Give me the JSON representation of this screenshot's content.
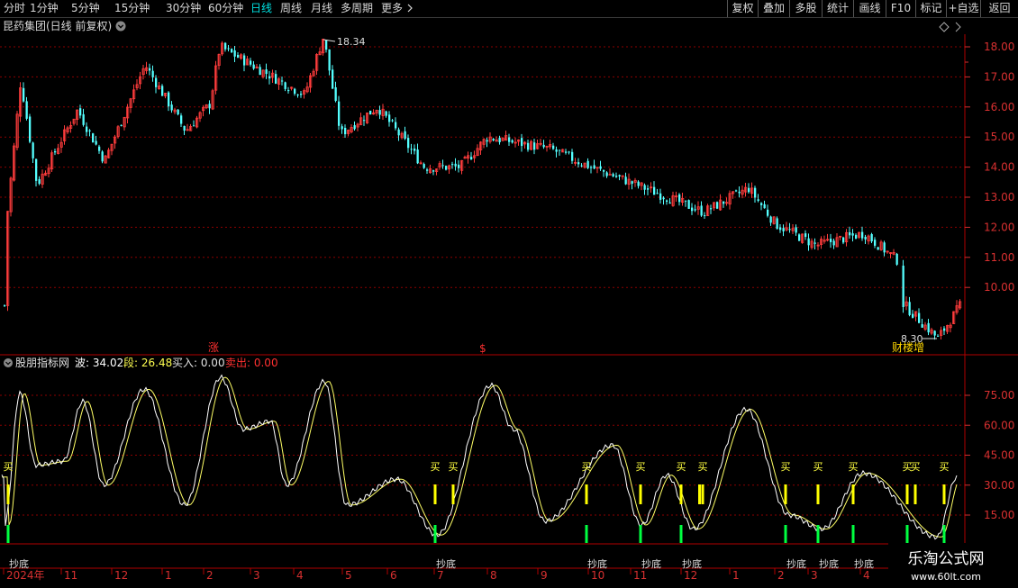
{
  "toolbar": {
    "timeframes": [
      {
        "label": "分时",
        "active": false
      },
      {
        "label": "1分钟",
        "active": false
      },
      {
        "label": "5分钟",
        "active": false
      },
      {
        "label": "15分钟",
        "active": false
      },
      {
        "label": "30分钟",
        "active": false
      },
      {
        "label": "60分钟",
        "active": false
      },
      {
        "label": "日线",
        "active": true
      },
      {
        "label": "周线",
        "active": false
      },
      {
        "label": "月线",
        "active": false
      },
      {
        "label": "多周期",
        "active": false
      }
    ],
    "more_label": "更多",
    "more_icon": "chevron-right-icon",
    "right_buttons": [
      "复权",
      "叠加",
      "多股",
      "统计",
      "画线",
      "F10",
      "标记",
      "+自选",
      "返回"
    ]
  },
  "header": {
    "stock_title": "昆药集团(日线 前复权)",
    "dropdown_icon": "chevron-down-icon",
    "diamond_icon": "diamond-icon"
  },
  "price_panel": {
    "high_label": "18.34",
    "low_label": "8.30",
    "markers": [
      "涨",
      "$"
    ],
    "event_label": "财楼增"
  },
  "indicator_panel": {
    "name": "股朋指标网",
    "wave_label": "波: 34.02",
    "segment_label": "段: 26.48",
    "buy_label": "买入: 0.00",
    "sell_label": "卖出: 0.00",
    "buy_signal_text": "买",
    "bottom_signal_text": "抄底"
  },
  "x_axis": {
    "month_labels": [
      "2024年",
      "11",
      "12",
      "1",
      "2",
      "3",
      "4",
      "5",
      "6",
      "7",
      "8",
      "9",
      "10",
      "11",
      "12",
      "1",
      "2",
      "3",
      "4"
    ]
  },
  "watermark": {
    "brand": "乐淘公式网",
    "url": "www.60lt.com"
  },
  "colors": {
    "up": "#ff3c3c",
    "down": "#54ffff",
    "wave_line": "#ffffff",
    "segment_line": "#ffff66",
    "buy_bar": "#ffff00",
    "bottom_bar": "#00ff40",
    "grid": "#8b0000",
    "active_tab": "#00e0e0"
  },
  "chart_data": [
    {
      "type": "candlestick",
      "title": "昆药集团(日线 前复权)",
      "ylim": [
        8.0,
        18.8
      ],
      "y_ticks": [
        10.0,
        11.0,
        12.0,
        13.0,
        14.0,
        15.0,
        16.0,
        17.0,
        18.0
      ],
      "close_keypoints": [
        {
          "x": "2024-10",
          "y": 11.8
        },
        {
          "x": "2024-10",
          "y": 16.9
        },
        {
          "x": "2024-10",
          "y": 13.4
        },
        {
          "x": "2024-11",
          "y": 15.9
        },
        {
          "x": "2024-11",
          "y": 14.2
        },
        {
          "x": "2024-12",
          "y": 17.4
        },
        {
          "x": "2024-12",
          "y": 15.2
        },
        {
          "x": "2025-01",
          "y": 16.1
        },
        {
          "x": "2025-02",
          "y": 18.0
        },
        {
          "x": "2025-03",
          "y": 17.2
        },
        {
          "x": "2025-04",
          "y": 16.4
        },
        {
          "x": "2025-04",
          "y": 18.34
        },
        {
          "x": "2025-05",
          "y": 15.1
        },
        {
          "x": "2025-05",
          "y": 16.0
        },
        {
          "x": "2025-06",
          "y": 14.0
        },
        {
          "x": "2025-07",
          "y": 14.0
        },
        {
          "x": "2025-08",
          "y": 15.0
        },
        {
          "x": "2025-09",
          "y": 14.6
        },
        {
          "x": "2025-10",
          "y": 14.0
        },
        {
          "x": "2025-11",
          "y": 13.6
        },
        {
          "x": "2025-12",
          "y": 12.5
        },
        {
          "x": "2026-01",
          "y": 13.3
        },
        {
          "x": "2026-02",
          "y": 12.1
        },
        {
          "x": "2026-03",
          "y": 11.4
        },
        {
          "x": "2026-03",
          "y": 11.8
        },
        {
          "x": "2026-04",
          "y": 10.9
        },
        {
          "x": "2026-04",
          "y": 9.5
        },
        {
          "x": "2026-04",
          "y": 8.3
        },
        {
          "x": "2026-04",
          "y": 9.4
        }
      ],
      "max_label": 18.34,
      "min_label": 8.3
    },
    {
      "type": "line",
      "title": "股朋指标网",
      "ylim": [
        0,
        90
      ],
      "y_ticks": [
        15.0,
        30.0,
        45.0,
        60.0,
        75.0
      ],
      "series": [
        {
          "name": "波",
          "last": 34.02,
          "keypoints": [
            {
              "x": "2024-10",
              "y": 10
            },
            {
              "x": "2024-10",
              "y": 76
            },
            {
              "x": "2024-10",
              "y": 40
            },
            {
              "x": "2024-11",
              "y": 42
            },
            {
              "x": "2024-11",
              "y": 72
            },
            {
              "x": "2024-11",
              "y": 30
            },
            {
              "x": "2024-12",
              "y": 78
            },
            {
              "x": "2024-12",
              "y": 20
            },
            {
              "x": "2025-01",
              "y": 84
            },
            {
              "x": "2025-02",
              "y": 58
            },
            {
              "x": "2025-02",
              "y": 62
            },
            {
              "x": "2025-03",
              "y": 30
            },
            {
              "x": "2025-04",
              "y": 82
            },
            {
              "x": "2025-05",
              "y": 20
            },
            {
              "x": "2025-06",
              "y": 33
            },
            {
              "x": "2025-07",
              "y": 5
            },
            {
              "x": "2025-08",
              "y": 80
            },
            {
              "x": "2025-09",
              "y": 58
            },
            {
              "x": "2025-09",
              "y": 12
            },
            {
              "x": "2025-10",
              "y": 50
            },
            {
              "x": "2025-11",
              "y": 10
            },
            {
              "x": "2025-11",
              "y": 35
            },
            {
              "x": "2025-12",
              "y": 8
            },
            {
              "x": "2026-01",
              "y": 68
            },
            {
              "x": "2026-02",
              "y": 15
            },
            {
              "x": "2026-03",
              "y": 8
            },
            {
              "x": "2026-03",
              "y": 36
            },
            {
              "x": "2026-04",
              "y": 4
            },
            {
              "x": "2026-04",
              "y": 34.02
            }
          ]
        },
        {
          "name": "段",
          "last": 26.48
        },
        {
          "name": "买入",
          "last": 0.0
        },
        {
          "name": "卖出",
          "last": 0.0
        }
      ],
      "buy_signal_months": [
        "2024-10",
        "2025-07",
        "2025-07",
        "2025-10",
        "2025-11",
        "2025-12",
        "2025-12",
        "2026-02",
        "2026-03",
        "2026-03",
        "2026-04",
        "2026-04",
        "2026-04"
      ],
      "bottom_signal_months": [
        "2024-10",
        "2025-07",
        "2025-10",
        "2025-11",
        "2025-12",
        "2026-02",
        "2026-03",
        "2026-03",
        "2026-04",
        "2026-04"
      ]
    }
  ]
}
